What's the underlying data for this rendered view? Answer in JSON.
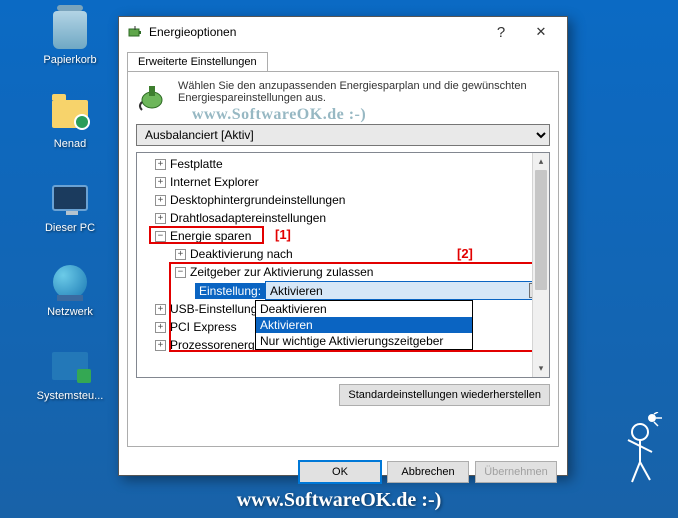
{
  "desktop": {
    "icons": [
      {
        "name": "recycle-bin",
        "label": "Papierkorb"
      },
      {
        "name": "user-folder",
        "label": "Nenad"
      },
      {
        "name": "this-pc",
        "label": "Dieser PC"
      },
      {
        "name": "network",
        "label": "Netzwerk"
      },
      {
        "name": "control-panel",
        "label": "Systemsteu..."
      }
    ]
  },
  "dialog": {
    "title": "Energieoptionen",
    "tab": "Erweiterte Einstellungen",
    "intro": "Wählen Sie den anzupassenden Energiesparplan und die gewünschten Energiespareinstellungen aus.",
    "plan_selected": "Ausbalanciert [Aktiv]",
    "tree": {
      "festplatte": "Festplatte",
      "ie": "Internet Explorer",
      "desktopbg": "Desktophintergrundeinstellungen",
      "wlan": "Drahtlosadaptereinstellungen",
      "energiesparen": "Energie sparen",
      "deaktivierung": "Deaktivierung nach",
      "zeitgeber": "Zeitgeber zur Aktivierung zulassen",
      "einstellung_label": "Einstellung:",
      "einstellung_value": "Aktivieren",
      "usb": "USB-Einstellungen",
      "pci": "PCI Express",
      "prozessor": "Prozessorenergieverwaltung"
    },
    "dropdown": {
      "opt0": "Deaktivieren",
      "opt1": "Aktivieren",
      "opt2": "Nur wichtige Aktivierungszeitgeber"
    },
    "restore_defaults": "Standardeinstellungen wiederherstellen",
    "ok": "OK",
    "cancel": "Abbrechen",
    "apply": "Übernehmen"
  },
  "annotations": {
    "a1": "[1]",
    "a2": "[2]"
  },
  "watermark": "www.SoftwareOK.de :-)"
}
